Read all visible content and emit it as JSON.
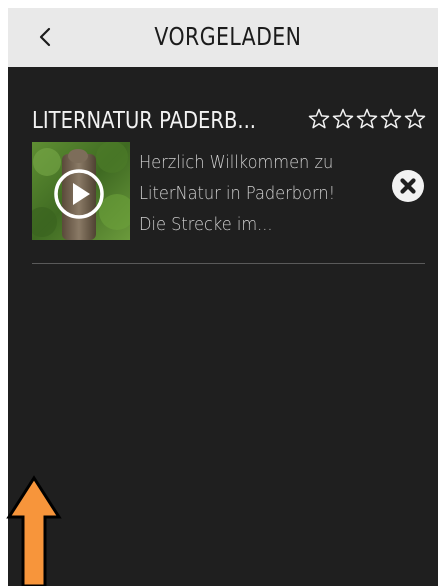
{
  "header": {
    "title": "VORGELADEN"
  },
  "item": {
    "title": "LITERNATUR PADERB...",
    "rating": {
      "value": 0,
      "max": 5
    },
    "description_lines": [
      "Herzlich Willkommen zu",
      "LiterNatur in Paderborn!",
      "Die Strecke im..."
    ]
  },
  "icons": {
    "back": "chevron-left-icon",
    "play": "play-icon",
    "remove": "close-circle-icon",
    "star": "star-outline-icon",
    "annotation_arrow": "arrow-up-icon"
  },
  "colors": {
    "header_bg": "#e9e9e9",
    "content_bg": "#1f1f1f",
    "title_text": "#f2f2f2",
    "body_text": "#cfcfcf",
    "annotation_arrow": "#f7953b"
  }
}
